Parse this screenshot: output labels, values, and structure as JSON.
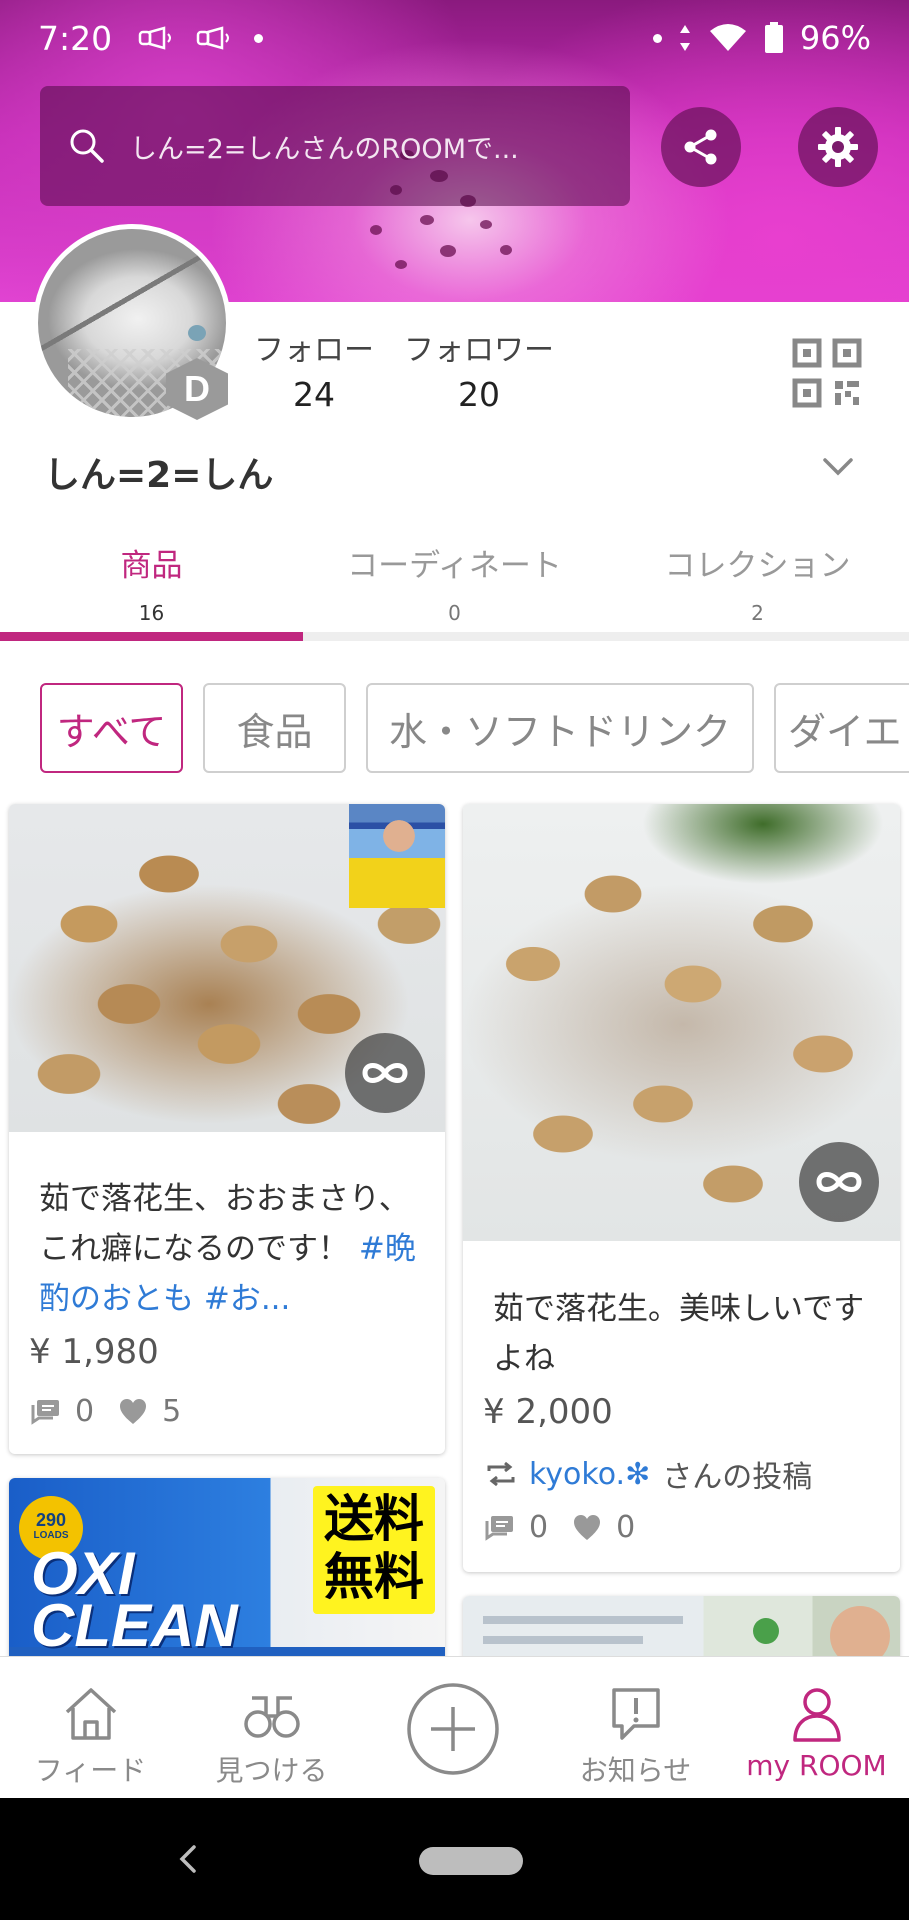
{
  "status_bar": {
    "time": "7:20",
    "battery": "96%",
    "icons": [
      "volume-icon",
      "volume-icon",
      "dot",
      "dot",
      "signal-icon",
      "wifi-icon",
      "battery-icon"
    ]
  },
  "header": {
    "search_placeholder": "しん=2=しんさんのROOMで...",
    "share_icon": "share-icon",
    "settings_icon": "gear-icon",
    "colors": {
      "banner": "#c22bb4",
      "accent": "#c0277f"
    }
  },
  "profile": {
    "avatar_badge": "D",
    "follow_label": "フォロー",
    "follow_count": "24",
    "follower_label": "フォロワー",
    "follower_count": "20",
    "username": "しん=2=しん",
    "qr_icon": "qr-code-icon"
  },
  "tabs": [
    {
      "label": "商品",
      "count": "16",
      "active": true
    },
    {
      "label": "コーディネート",
      "count": "0",
      "active": false
    },
    {
      "label": "コレクション",
      "count": "2",
      "active": false
    }
  ],
  "chips": [
    "すべて",
    "食品",
    "水・ソフトドリンク",
    "ダイエ"
  ],
  "cards": [
    {
      "desc_text": "茹で落花生、おおまさり、これ癖になるのです！",
      "desc_tags": " #晩酌のおとも #お...",
      "price": "¥ 1,980",
      "comments": "0",
      "likes": "5"
    },
    {
      "desc_text": "茹で落花生。美味しいですよね",
      "price": "¥ 2,000",
      "repost_user": "kyoko.✻",
      "repost_suffix": "さんの投稿",
      "comments": "0",
      "likes": "0"
    },
    {
      "loads_number": "290",
      "loads_label": "LOADS",
      "brand_line1": "OXI",
      "brand_line2": "CLEAN",
      "badge_line1": "送料",
      "badge_line2": "無料"
    }
  ],
  "bottom_nav": [
    {
      "label": "フィード",
      "icon": "home-icon",
      "active": false
    },
    {
      "label": "見つける",
      "icon": "binoculars-icon",
      "active": false
    },
    {
      "label": "",
      "icon": "add-circle-icon",
      "active": false
    },
    {
      "label": "お知らせ",
      "icon": "notification-icon",
      "active": false
    },
    {
      "label": "my ROOM",
      "icon": "person-icon",
      "active": true
    }
  ]
}
